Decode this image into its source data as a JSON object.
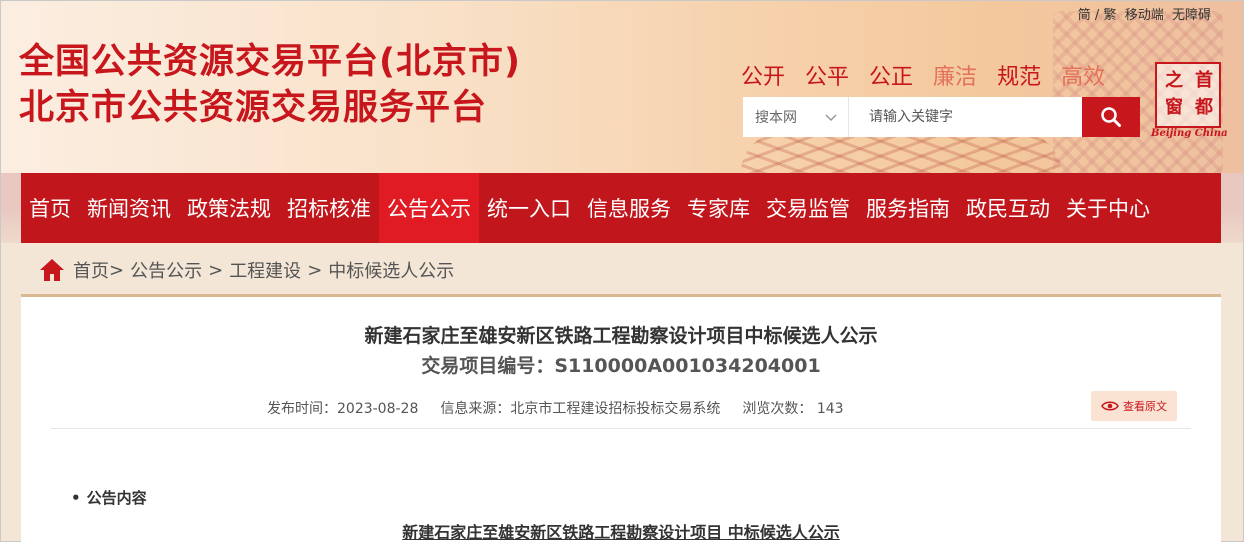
{
  "header": {
    "topbar": {
      "lang_simple": "简",
      "lang_sep": "/",
      "lang_trad": "繁",
      "mobile": "移动端",
      "accessible": "无障碍"
    },
    "site_title_line1": "全国公共资源交易平台(北京市)",
    "site_title_line2": "北京市公共资源交易服务平台",
    "values": [
      "公开",
      "公平",
      "公正",
      "廉洁",
      "规范",
      "高效"
    ],
    "search": {
      "scope": "搜本网",
      "placeholder": "请输入关键字"
    },
    "logo": {
      "chars": [
        "首",
        "都",
        "之",
        "窗"
      ],
      "en": "Beijing China"
    }
  },
  "nav": {
    "items": [
      "首页",
      "新闻资讯",
      "政策法规",
      "招标核准",
      "公告公示",
      "统一入口",
      "信息服务",
      "专家库",
      "交易监管",
      "服务指南",
      "政民互动",
      "关于中心"
    ],
    "active_index": 4
  },
  "breadcrumb": {
    "items": [
      "首页",
      "公告公示",
      "工程建设",
      "中标候选人公示"
    ],
    "seps": [
      ">",
      ">",
      ">"
    ]
  },
  "article": {
    "title": "新建石家庄至雄安新区铁路工程勘察设计项目中标候选人公示",
    "code": "交易项目编号：S110000A001034204001",
    "meta": {
      "publish_label": "发布时间：",
      "publish_value": "2023-08-28",
      "source_label": "信息来源：",
      "source_value": "北京市工程建设招标投标交易系统",
      "views_label": "浏览次数：",
      "views_value": "143"
    },
    "view_original": "查看原文",
    "section_head": "公告内容",
    "subtitle": "新建石家庄至雄安新区铁路工程勘察设计项目 中标候选人公示"
  },
  "colors": {
    "brand_red": "#c8161d",
    "nav_red": "#c1161c",
    "nav_active": "#e11b23"
  }
}
